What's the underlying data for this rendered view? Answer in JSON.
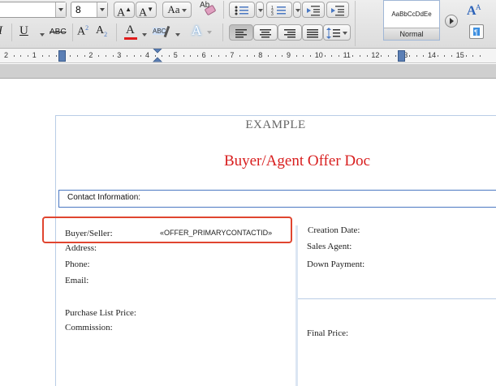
{
  "toolbar": {
    "font_name": "",
    "font_size": "8",
    "grow_font": "A",
    "shrink_font": "A",
    "change_case": "Aa",
    "clear_formatting": "Ab",
    "italic": "I",
    "underline": "U",
    "strikethrough": "ABC",
    "superscript": "A",
    "superscript_sup": "2",
    "subscript": "A",
    "subscript_sub": "2",
    "font_color": "A",
    "highlight": "ABC",
    "text_effects": "A",
    "style_preview": "AaBbCcDdEe",
    "style_name": "Normal",
    "font_color_swatch": "#e01b1b",
    "accent": "#4a78c2"
  },
  "ruler": {
    "numbers": [
      "2",
      "1",
      "1",
      "2",
      "3",
      "4",
      "5",
      "6",
      "7",
      "8",
      "9",
      "10",
      "11",
      "12",
      "13",
      "14",
      "15"
    ]
  },
  "document": {
    "header": "EXAMPLE",
    "title": "Buyer/Agent Offer Doc",
    "title_color": "#d81e1e",
    "section_label": "Contact Information:",
    "left_fields": {
      "buyer_seller_label": "Buyer/Seller:",
      "buyer_seller_value": "«OFFER_PRIMARYCONTACTID»",
      "address_label": "Address:",
      "phone_label": "Phone:",
      "email_label": "Email:",
      "purchase_price_label": "Purchase List Price:",
      "commission_label": "Commission:"
    },
    "right_fields": {
      "creation_date_label": "Creation Date:",
      "sales_agent_label": "Sales Agent:",
      "down_payment_label": "Down Payment:",
      "final_price_label": "Final Price:"
    },
    "highlight_color": "#e0452f"
  }
}
